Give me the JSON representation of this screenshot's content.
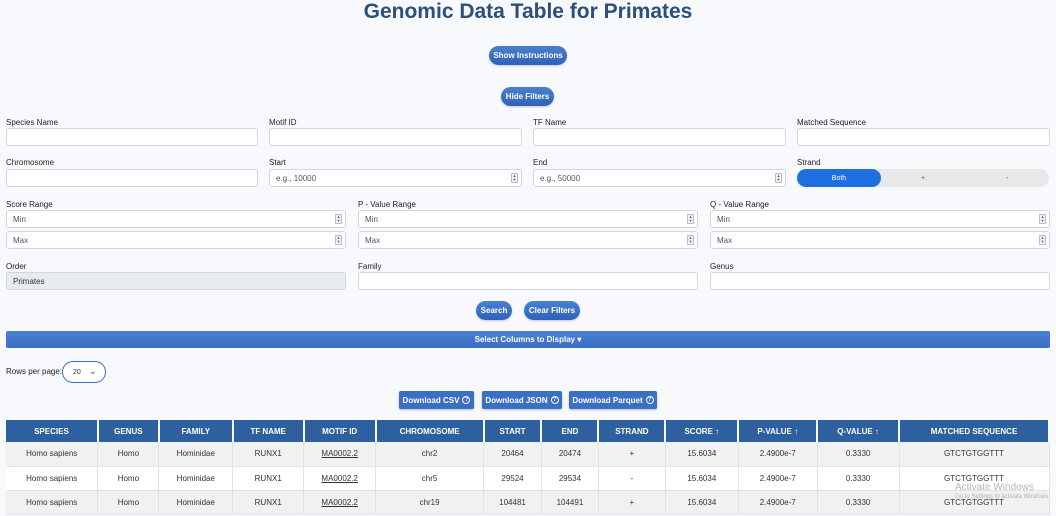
{
  "title": "Genomic Data Table for Primates",
  "buttons": {
    "show_instructions": "Show Instructions",
    "hide_filters": "Hide Filters",
    "search": "Search",
    "clear_filters": "Clear Filters",
    "select_columns": "Select Columns to Display ▾"
  },
  "filters": {
    "species_name": {
      "label": "Species Name",
      "value": ""
    },
    "motif_id": {
      "label": "Motif ID",
      "value": ""
    },
    "tf_name": {
      "label": "TF Name",
      "value": ""
    },
    "matched_sequence": {
      "label": "Matched Sequence",
      "value": ""
    },
    "chromosome": {
      "label": "Chromosome",
      "value": ""
    },
    "start": {
      "label": "Start",
      "placeholder": "e.g., 10000"
    },
    "end": {
      "label": "End",
      "placeholder": "e.g., 50000"
    },
    "strand": {
      "label": "Strand",
      "options": [
        "Both",
        "+",
        "-"
      ],
      "selected": "Both"
    },
    "score_range": {
      "label": "Score Range",
      "min_placeholder": "Min",
      "max_placeholder": "Max"
    },
    "p_value_range": {
      "label": "P - Value Range",
      "min_placeholder": "Min",
      "max_placeholder": "Max"
    },
    "q_value_range": {
      "label": "Q - Value Range",
      "min_placeholder": "Min",
      "max_placeholder": "Max"
    },
    "order": {
      "label": "Order",
      "value": "Primates"
    },
    "family": {
      "label": "Family",
      "value": ""
    },
    "genus": {
      "label": "Genus",
      "value": ""
    }
  },
  "rows_per_page": {
    "label": "Rows per page:",
    "value": "20"
  },
  "downloads": {
    "csv": "Download CSV",
    "json": "Download JSON",
    "parquet": "Download Parquet",
    "help_icon": "?"
  },
  "table": {
    "headers": [
      "SPECIES",
      "GENUS",
      "FAMILY",
      "TF NAME",
      "MOTIF ID",
      "CHROMOSOME",
      "START",
      "END",
      "STRAND",
      "SCORE ↑",
      "P-VALUE ↑",
      "Q-VALUE ↑",
      "MATCHED SEQUENCE"
    ],
    "rows": [
      [
        "Homo sapiens",
        "Homo",
        "Hominidae",
        "RUNX1",
        "MA0002.2",
        "chr2",
        "20464",
        "20474",
        "+",
        "15.6034",
        "2.4900e-7",
        "0.3330",
        "GTCTGTGGTTT"
      ],
      [
        "Homo sapiens",
        "Homo",
        "Hominidae",
        "RUNX1",
        "MA0002.2",
        "chr5",
        "29524",
        "29534",
        "-",
        "15.6034",
        "2.4900e-7",
        "0.3330",
        "GTCTGTGGTTT"
      ],
      [
        "Homo sapiens",
        "Homo",
        "Hominidae",
        "RUNX1",
        "MA0002.2",
        "chr19",
        "104481",
        "104491",
        "+",
        "15.6034",
        "2.4900e-7",
        "0.3330",
        "GTCTGTGGTTT"
      ]
    ]
  },
  "watermark": {
    "line1": "Activate Windows",
    "line2": "Go to Settings to activate Windows."
  },
  "colors": {
    "accent": "#3a6fc6",
    "header": "#2e5f9e",
    "title": "#2d4f7c",
    "strand_active": "#1f6fe0"
  }
}
